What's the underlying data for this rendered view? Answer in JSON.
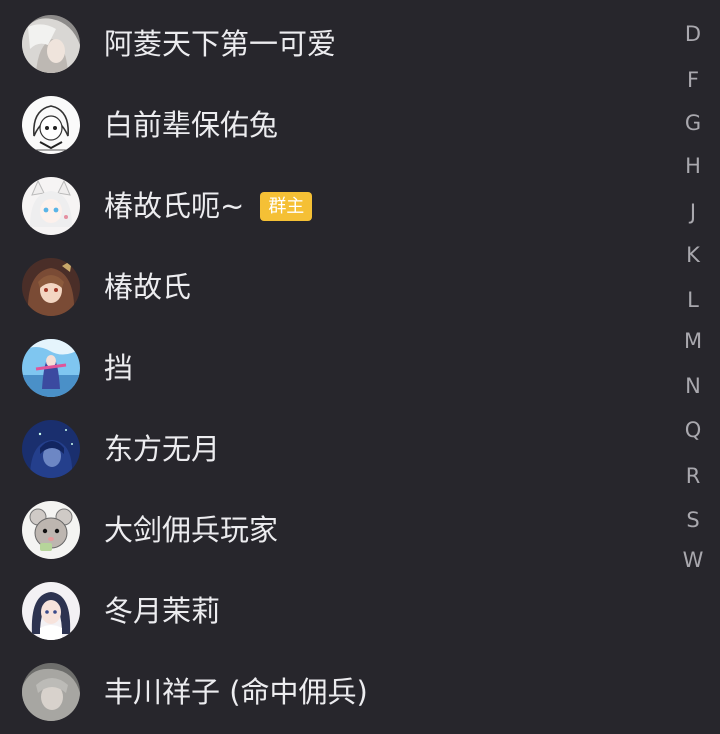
{
  "members": [
    {
      "name": "阿菱天下第一可爱",
      "avatar": "grey-haired-anime-avatar-icon",
      "badge": ""
    },
    {
      "name": "白前辈保佑兔",
      "avatar": "sketch-anime-girl-avatar-icon",
      "badge": ""
    },
    {
      "name": "椿故氏呃~",
      "avatar": "white-cat-ear-girl-avatar-icon",
      "badge": "群主"
    },
    {
      "name": "椿故氏",
      "avatar": "brown-haired-girl-avatar-icon",
      "badge": ""
    },
    {
      "name": "挡",
      "avatar": "blue-sky-girl-avatar-icon",
      "badge": ""
    },
    {
      "name": "东方无月",
      "avatar": "dark-blue-night-avatar-icon",
      "badge": ""
    },
    {
      "name": "大剑佣兵玩家",
      "avatar": "mouse-face-avatar-icon",
      "badge": ""
    },
    {
      "name": "冬月茉莉",
      "avatar": "dark-haired-girl-avatar-icon",
      "badge": ""
    },
    {
      "name": "丰川祥子 (命中佣兵)",
      "avatar": "grey-haired-girl-avatar-icon",
      "badge": ""
    }
  ],
  "index_letters": [
    "D",
    "F",
    "G",
    "H",
    "J",
    "K",
    "L",
    "M",
    "N",
    "Q",
    "R",
    "S",
    "W"
  ],
  "colors": {
    "background": "#27262c",
    "text": "#ececef",
    "index_text": "#a9a8ae",
    "badge_background": "#f5c035"
  }
}
